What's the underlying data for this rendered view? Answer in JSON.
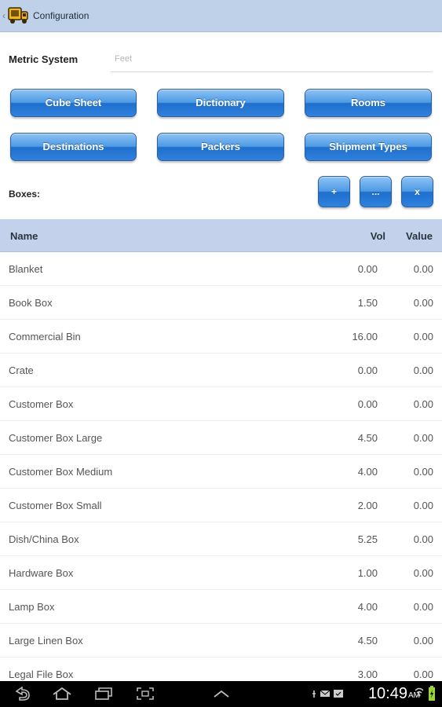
{
  "actionbar": {
    "title": "Configuration",
    "icon": "truck-icon"
  },
  "metric": {
    "label": "Metric System",
    "value": "Feet"
  },
  "buttons": {
    "cube_sheet": "Cube Sheet",
    "dictionary": "Dictionary",
    "rooms": "Rooms",
    "destinations": "Destinations",
    "packers": "Packers",
    "shipment_types": "Shipment Types"
  },
  "boxes": {
    "label": "Boxes:",
    "add": "+",
    "more": "...",
    "remove": "x"
  },
  "table": {
    "headers": {
      "name": "Name",
      "vol": "Vol",
      "value": "Value"
    },
    "rows": [
      {
        "name": "Blanket",
        "vol": "0.00",
        "value": "0.00"
      },
      {
        "name": "Book Box",
        "vol": "1.50",
        "value": "0.00"
      },
      {
        "name": "Commercial Bin",
        "vol": "16.00",
        "value": "0.00"
      },
      {
        "name": "Crate",
        "vol": "0.00",
        "value": "0.00"
      },
      {
        "name": "Customer Box",
        "vol": "0.00",
        "value": "0.00"
      },
      {
        "name": "Customer Box Large",
        "vol": "4.50",
        "value": "0.00"
      },
      {
        "name": "Customer Box Medium",
        "vol": "4.00",
        "value": "0.00"
      },
      {
        "name": "Customer Box Small",
        "vol": "2.00",
        "value": "0.00"
      },
      {
        "name": "Dish/China Box",
        "vol": "5.25",
        "value": "0.00"
      },
      {
        "name": "Hardware Box",
        "vol": "1.00",
        "value": "0.00"
      },
      {
        "name": "Lamp Box",
        "vol": "4.00",
        "value": "0.00"
      },
      {
        "name": "Large Linen Box",
        "vol": "4.50",
        "value": "0.00"
      },
      {
        "name": "Legal File Box",
        "vol": "3.00",
        "value": "0.00"
      }
    ]
  },
  "statusbar": {
    "time": "10:49",
    "ampm": "AM"
  },
  "colors": {
    "actionbar": "#bfd0e9",
    "button": "#2f82de",
    "table_header": "#c3d2ea"
  }
}
